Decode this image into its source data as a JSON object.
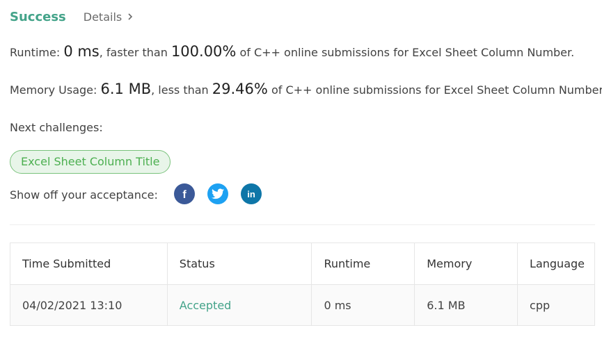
{
  "header": {
    "status": "Success",
    "details_label": "Details"
  },
  "runtime_line": {
    "label": "Runtime:",
    "value": "0 ms",
    "compare_text": ", faster than",
    "percent": "100.00%",
    "suffix": "of C++ online submissions for Excel Sheet Column Number."
  },
  "memory_line": {
    "label": "Memory Usage:",
    "value": "6.1 MB",
    "compare_text": ", less than",
    "percent": "29.46%",
    "suffix": "of C++ online submissions for Excel Sheet Column Number."
  },
  "next_challenges": {
    "label": "Next challenges:",
    "items": [
      "Excel Sheet Column Title"
    ]
  },
  "share": {
    "label": "Show off your acceptance:",
    "icons": [
      "facebook-icon",
      "twitter-icon",
      "linkedin-icon"
    ]
  },
  "submissions_table": {
    "columns": [
      "Time Submitted",
      "Status",
      "Runtime",
      "Memory",
      "Language"
    ],
    "rows": [
      [
        "04/02/2021 13:10",
        "Accepted",
        "0 ms",
        "6.1 MB",
        "cpp"
      ]
    ]
  },
  "colors": {
    "success": "#43a389",
    "pill_border": "#79c27b",
    "pill_bg": "#e8f5e9",
    "facebook": "#3b5998",
    "twitter": "#1da1f2",
    "linkedin": "#0e76a8"
  }
}
